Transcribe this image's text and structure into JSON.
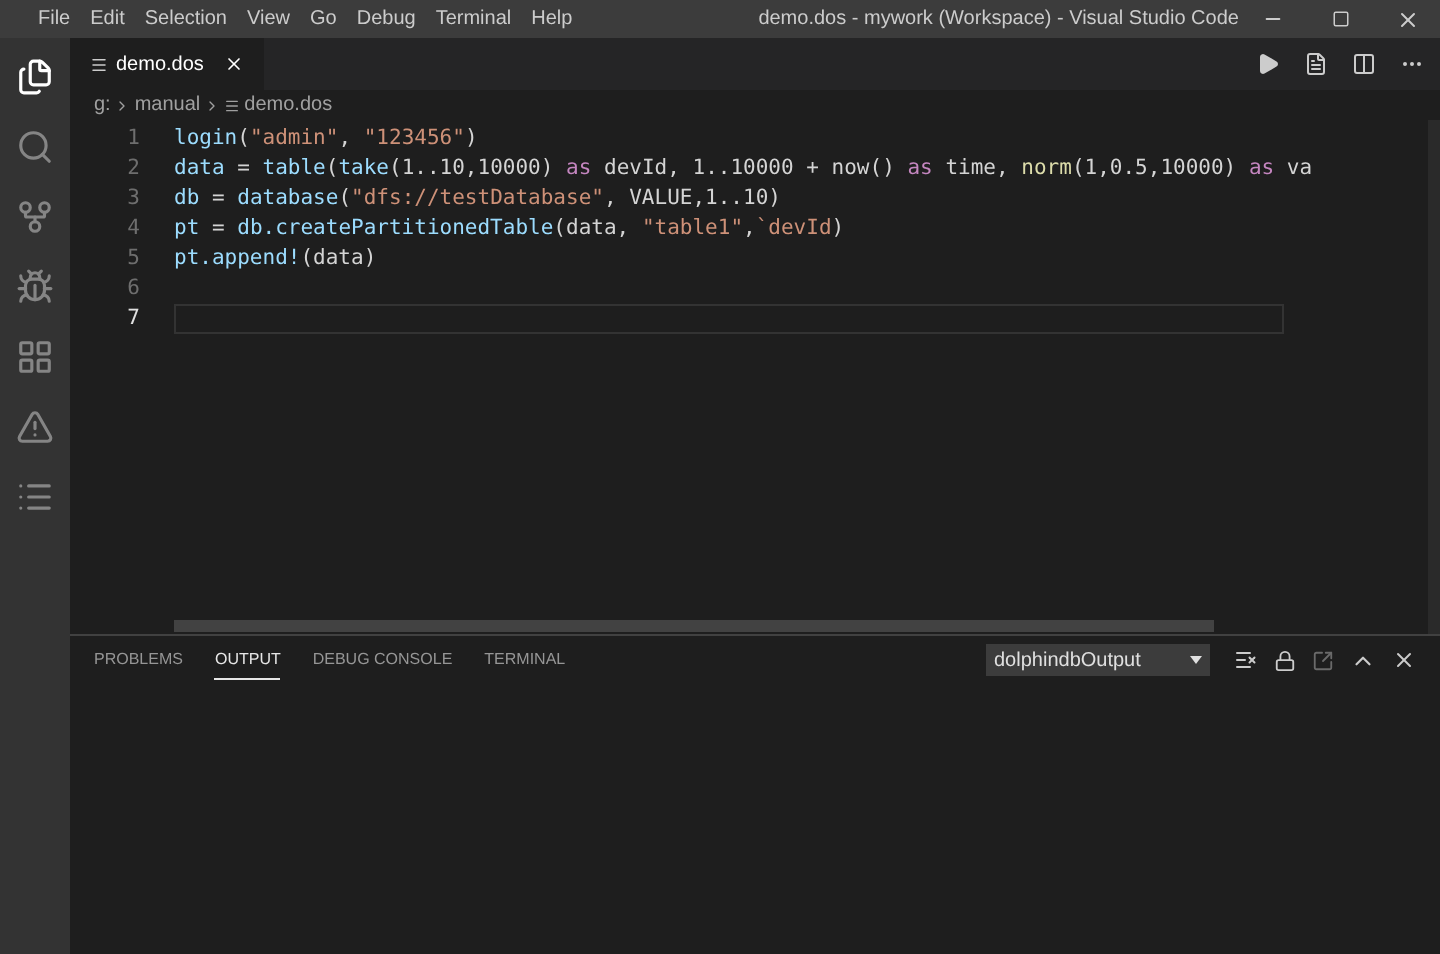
{
  "window": {
    "title": "demo.dos - mywork (Workspace) - Visual Studio Code"
  },
  "menu": [
    "File",
    "Edit",
    "Selection",
    "View",
    "Go",
    "Debug",
    "Terminal",
    "Help"
  ],
  "editor_tab": {
    "label": "demo.dos",
    "selected": true
  },
  "breadcrumb": [
    "g:",
    "manual",
    "demo.dos"
  ],
  "code_lines": [
    {
      "number": "1",
      "active": false,
      "tokens": [
        {
          "text": "login",
          "kind": "var"
        },
        {
          "text": "(",
          "kind": "plain"
        },
        {
          "text": "\"admin\"",
          "kind": "str"
        },
        {
          "text": ", ",
          "kind": "plain"
        },
        {
          "text": "\"123456\"",
          "kind": "str"
        },
        {
          "text": ")",
          "kind": "plain"
        }
      ]
    },
    {
      "number": "2",
      "active": false,
      "tokens": [
        {
          "text": "data",
          "kind": "var"
        },
        {
          "text": " = ",
          "kind": "plain"
        },
        {
          "text": "table",
          "kind": "var"
        },
        {
          "text": "(",
          "kind": "plain"
        },
        {
          "text": "take",
          "kind": "var"
        },
        {
          "text": "(1..10,10000) ",
          "kind": "plain"
        },
        {
          "text": "as",
          "kind": "kw"
        },
        {
          "text": " devId, 1..10000 + now() ",
          "kind": "plain"
        },
        {
          "text": "as",
          "kind": "kw"
        },
        {
          "text": " time, ",
          "kind": "plain"
        },
        {
          "text": "norm",
          "kind": "func"
        },
        {
          "text": "(1,0.5,10000) ",
          "kind": "plain"
        },
        {
          "text": "as",
          "kind": "kw"
        },
        {
          "text": " va",
          "kind": "plain"
        }
      ]
    },
    {
      "number": "3",
      "active": false,
      "tokens": [
        {
          "text": "db",
          "kind": "var"
        },
        {
          "text": " = ",
          "kind": "plain"
        },
        {
          "text": "database",
          "kind": "var"
        },
        {
          "text": "(",
          "kind": "plain"
        },
        {
          "text": "\"dfs://testDatabase\"",
          "kind": "str"
        },
        {
          "text": ", VALUE,1..10)",
          "kind": "plain"
        }
      ]
    },
    {
      "number": "4",
      "active": false,
      "tokens": [
        {
          "text": "pt",
          "kind": "var"
        },
        {
          "text": " = ",
          "kind": "plain"
        },
        {
          "text": "db.createPartitionedTable",
          "kind": "var"
        },
        {
          "text": "(data, ",
          "kind": "plain"
        },
        {
          "text": "\"table1\"",
          "kind": "str"
        },
        {
          "text": ",",
          "kind": "plain"
        },
        {
          "text": "`devId",
          "kind": "str"
        },
        {
          "text": ")",
          "kind": "plain"
        }
      ]
    },
    {
      "number": "5",
      "active": false,
      "tokens": [
        {
          "text": "pt.append!",
          "kind": "var"
        },
        {
          "text": "(data)",
          "kind": "plain"
        }
      ]
    },
    {
      "number": "6",
      "active": false
    },
    {
      "number": "7",
      "active": true
    }
  ],
  "panel": {
    "tabs": [
      {
        "label": "PROBLEMS",
        "selected": false
      },
      {
        "label": "OUTPUT",
        "selected": true
      },
      {
        "label": "DEBUG CONSOLE",
        "selected": false
      },
      {
        "label": "TERMINAL",
        "selected": false
      }
    ],
    "output_channel": "dolphindbOutput"
  }
}
